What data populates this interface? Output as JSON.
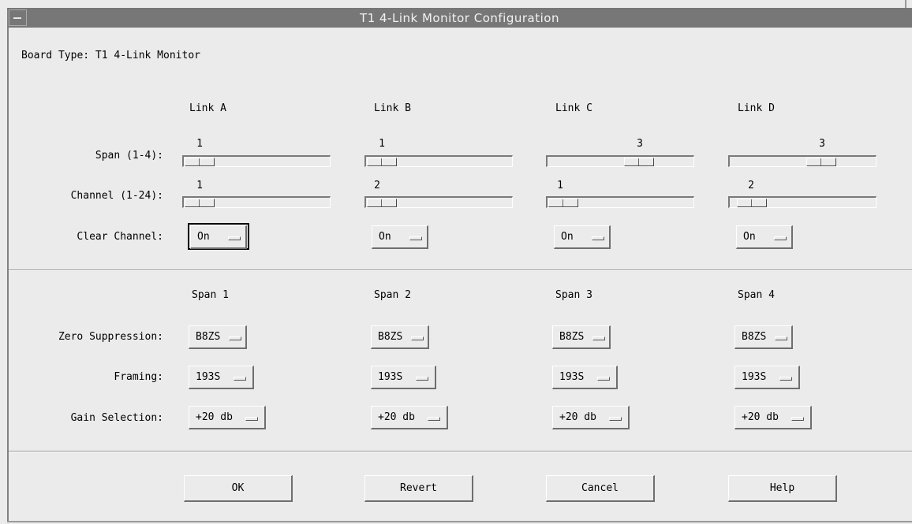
{
  "window": {
    "title": "T1 4-Link Monitor Configuration"
  },
  "board_type": "Board Type: T1 4-Link Monitor",
  "links": {
    "headers": [
      "Link A",
      "Link B",
      "Link C",
      "Link D"
    ],
    "row_labels": {
      "span": "Span (1-4):",
      "channel": "Channel (1-24):",
      "clear_channel": "Clear Channel:"
    },
    "span_values": [
      "1",
      "1",
      "3",
      "3"
    ],
    "channel_values": [
      "1",
      "2",
      "1",
      "2"
    ],
    "clear_channel_values": [
      "On",
      "On",
      "On",
      "On"
    ]
  },
  "spans": {
    "headers": [
      "Span 1",
      "Span 2",
      "Span 3",
      "Span 4"
    ],
    "row_labels": {
      "zero_suppression": "Zero Suppression:",
      "framing": "Framing:",
      "gain_selection": "Gain Selection:"
    },
    "zero_suppression_values": [
      "B8ZS",
      "B8ZS",
      "B8ZS",
      "B8ZS"
    ],
    "framing_values": [
      "193S",
      "193S",
      "193S",
      "193S"
    ],
    "gain_selection_values": [
      "+20 db",
      "+20 db",
      "+20 db",
      "+20 db"
    ]
  },
  "buttons": {
    "ok": "OK",
    "revert": "Revert",
    "cancel": "Cancel",
    "help": "Help"
  },
  "colors": {
    "background": "#ebebeb",
    "titlebar": "#777777",
    "title_text": "#f2f2f2"
  }
}
